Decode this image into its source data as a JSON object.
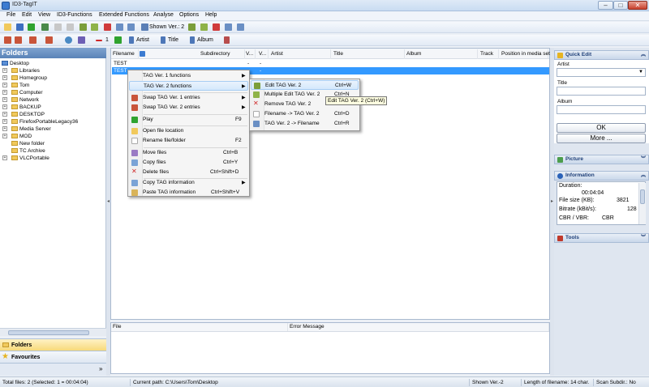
{
  "window": {
    "title": "ID3-TagIT",
    "min": "–",
    "max": "□",
    "close": "✕"
  },
  "menubar": [
    "File",
    "Edit",
    "View",
    "ID3-Functions",
    "Extended Functions",
    "Analyse",
    "Options",
    "Help"
  ],
  "toolbar1": {
    "shown_ver": "Shown Ver.: 2"
  },
  "toolbar2": {
    "num": "1",
    "artist": "Artist",
    "title": "Title",
    "album": "Album"
  },
  "left_panel": {
    "header": "Folders",
    "tree": [
      {
        "label": "Desktop",
        "level": 0,
        "exp": ""
      },
      {
        "label": "Libraries",
        "level": 1,
        "exp": "+"
      },
      {
        "label": "Homegroup",
        "level": 1,
        "exp": "+"
      },
      {
        "label": "Tom",
        "level": 1,
        "exp": "+"
      },
      {
        "label": "Computer",
        "level": 1,
        "exp": "+"
      },
      {
        "label": "Network",
        "level": 1,
        "exp": "+"
      },
      {
        "label": "BACKUP",
        "level": 1,
        "exp": "+"
      },
      {
        "label": "DESKTOP",
        "level": 1,
        "exp": "+"
      },
      {
        "label": "FirefoxPortableLegacy36",
        "level": 1,
        "exp": "+"
      },
      {
        "label": "Media Server",
        "level": 1,
        "exp": "+"
      },
      {
        "label": "MOD",
        "level": 1,
        "exp": "+"
      },
      {
        "label": "New folder",
        "level": 1,
        "exp": ""
      },
      {
        "label": "TC Archive",
        "level": 1,
        "exp": ""
      },
      {
        "label": "VLCPortable",
        "level": 1,
        "exp": "+"
      }
    ],
    "nav_folders": "Folders",
    "nav_favourites": "Favourites",
    "nav_more": "»"
  },
  "file_list": {
    "columns": [
      "Filename",
      "Subdirectory",
      "V...",
      "V...",
      "Artist",
      "Title",
      "Album",
      "Track",
      "Position in media set"
    ],
    "rows": [
      {
        "filename": "TEST",
        "v1": "-",
        "v2": "-",
        "selected": false
      },
      {
        "filename": "TEST",
        "v1": "",
        "v2": "-",
        "selected": true
      }
    ]
  },
  "error_list": {
    "columns": [
      "File",
      "Error Message"
    ]
  },
  "context_menu": {
    "items": [
      {
        "label": "TAG Ver. 1 functions",
        "shortcut": "",
        "arrow": "▶"
      },
      {
        "label": "TAG Ver. 2 functions",
        "shortcut": "",
        "arrow": "▶"
      },
      {
        "label": "Swap TAG Ver. 1 entries",
        "shortcut": "",
        "arrow": "▶"
      },
      {
        "label": "Swap TAG Ver. 2 entries",
        "shortcut": "",
        "arrow": "▶"
      },
      {
        "label": "Play",
        "shortcut": "F9",
        "arrow": ""
      },
      {
        "label": "Open file location",
        "shortcut": "",
        "arrow": ""
      },
      {
        "label": "Rename file/folder",
        "shortcut": "F2",
        "arrow": ""
      },
      {
        "label": "Move files",
        "shortcut": "Ctrl+B",
        "arrow": ""
      },
      {
        "label": "Copy files",
        "shortcut": "Ctrl+Y",
        "arrow": ""
      },
      {
        "label": "Delete files",
        "shortcut": "Ctrl+Shift+D",
        "arrow": ""
      },
      {
        "label": "Copy TAG information",
        "shortcut": "",
        "arrow": "▶"
      },
      {
        "label": "Paste TAG information",
        "shortcut": "Ctrl+Shift+V",
        "arrow": ""
      }
    ]
  },
  "submenu": {
    "items": [
      {
        "label": "Edit TAG Ver. 2",
        "shortcut": "Ctrl+W"
      },
      {
        "label": "Multiple Edit TAG Ver. 2",
        "shortcut": "Ctrl+N"
      },
      {
        "label": "Remove TAG Ver. 2",
        "shortcut": ""
      },
      {
        "label": "Filename -> TAG Ver. 2",
        "shortcut": "Ctrl+D"
      },
      {
        "label": "TAG Ver. 2 -> Filename",
        "shortcut": "Ctrl+R"
      }
    ]
  },
  "tooltip": "Edit TAG Ver. 2 (Ctrl+W)",
  "right_panel": {
    "quick_edit": "Quick Edit",
    "artist_label": "Artist",
    "title_label": "Title",
    "album_label": "Album",
    "ok": "OK",
    "more": "More ...",
    "picture": "Picture",
    "information": "Information",
    "duration_label": "Duration:",
    "duration_value": "00:04:04",
    "filesize_label": "File size (KB):",
    "filesize_value": "3821",
    "bitrate_label": "Bitrate (kBit/s):",
    "bitrate_value": "128",
    "cbrvbr_label": "CBR / VBR:",
    "cbrvbr_value": "CBR",
    "tools": "Tools"
  },
  "statusbar": {
    "total": "Total files: 2 (Selected: 1 = 00:04:04)",
    "path": "Current path: C:\\Users\\Tom\\Desktop",
    "shown": "Shown Ver.-2",
    "length": "Length of filename: 14 char.",
    "scan": "Scan Subdir.: No"
  },
  "colors": {
    "accent": "#3399ff",
    "selection": "#3399ff",
    "folder": "#f1c95c"
  }
}
